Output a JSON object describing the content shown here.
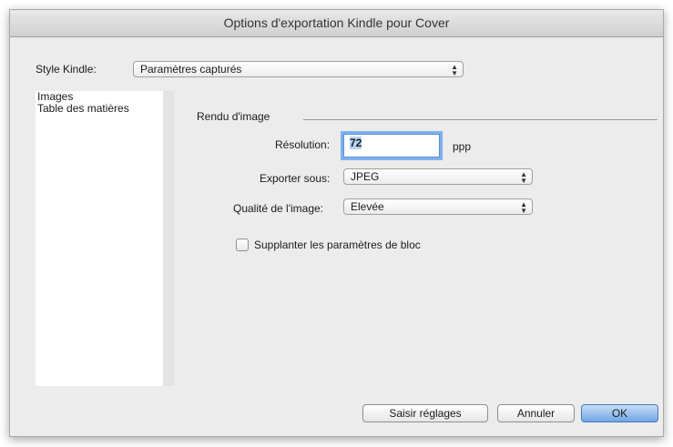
{
  "window": {
    "title": "Options d'exportation Kindle pour Cover"
  },
  "style_kindle": {
    "label": "Style Kindle:",
    "value": "Paramètres capturés"
  },
  "sidebar": {
    "items": [
      {
        "label": "Images"
      },
      {
        "label": "Table des matières"
      }
    ]
  },
  "section": {
    "title": "Rendu d'image"
  },
  "resolution": {
    "label": "Résolution:",
    "value": "72",
    "unit": "ppp"
  },
  "export_as": {
    "label": "Exporter sous:",
    "value": "JPEG"
  },
  "quality": {
    "label": "Qualité de l'image:",
    "value": "Elevée"
  },
  "override": {
    "label": "Supplanter les paramètres de bloc",
    "checked": false
  },
  "buttons": {
    "settings": "Saisir réglages",
    "cancel": "Annuler",
    "ok": "OK"
  }
}
